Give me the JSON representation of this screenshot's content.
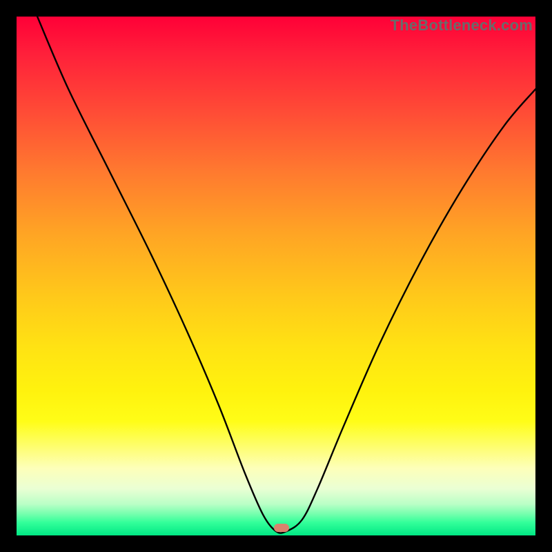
{
  "watermark": "TheBottleneck.com",
  "chart_data": {
    "type": "line",
    "title": "",
    "xlabel": "",
    "ylabel": "",
    "xlim": [
      0,
      100
    ],
    "ylim": [
      0,
      100
    ],
    "grid": false,
    "legend": false,
    "series": [
      {
        "name": "curve",
        "color": "#000000",
        "x": [
          4,
          10,
          18,
          26,
          33,
          39,
          44,
          47.5,
          50,
          52,
          55,
          58,
          63,
          70,
          78,
          86,
          94,
          100
        ],
        "y": [
          100,
          86,
          70,
          54,
          39,
          25,
          12,
          4,
          0.8,
          0.8,
          3,
          9,
          21,
          37,
          53,
          67,
          79,
          86
        ]
      }
    ],
    "marker": {
      "x": 51,
      "y": 1.5,
      "color": "#d9836d"
    },
    "background_gradient": {
      "type": "vertical",
      "stops": [
        {
          "pos": 0,
          "color": "#ff0037"
        },
        {
          "pos": 50,
          "color": "#ffc400"
        },
        {
          "pos": 85,
          "color": "#fdffb0"
        },
        {
          "pos": 100,
          "color": "#00e884"
        }
      ]
    }
  }
}
